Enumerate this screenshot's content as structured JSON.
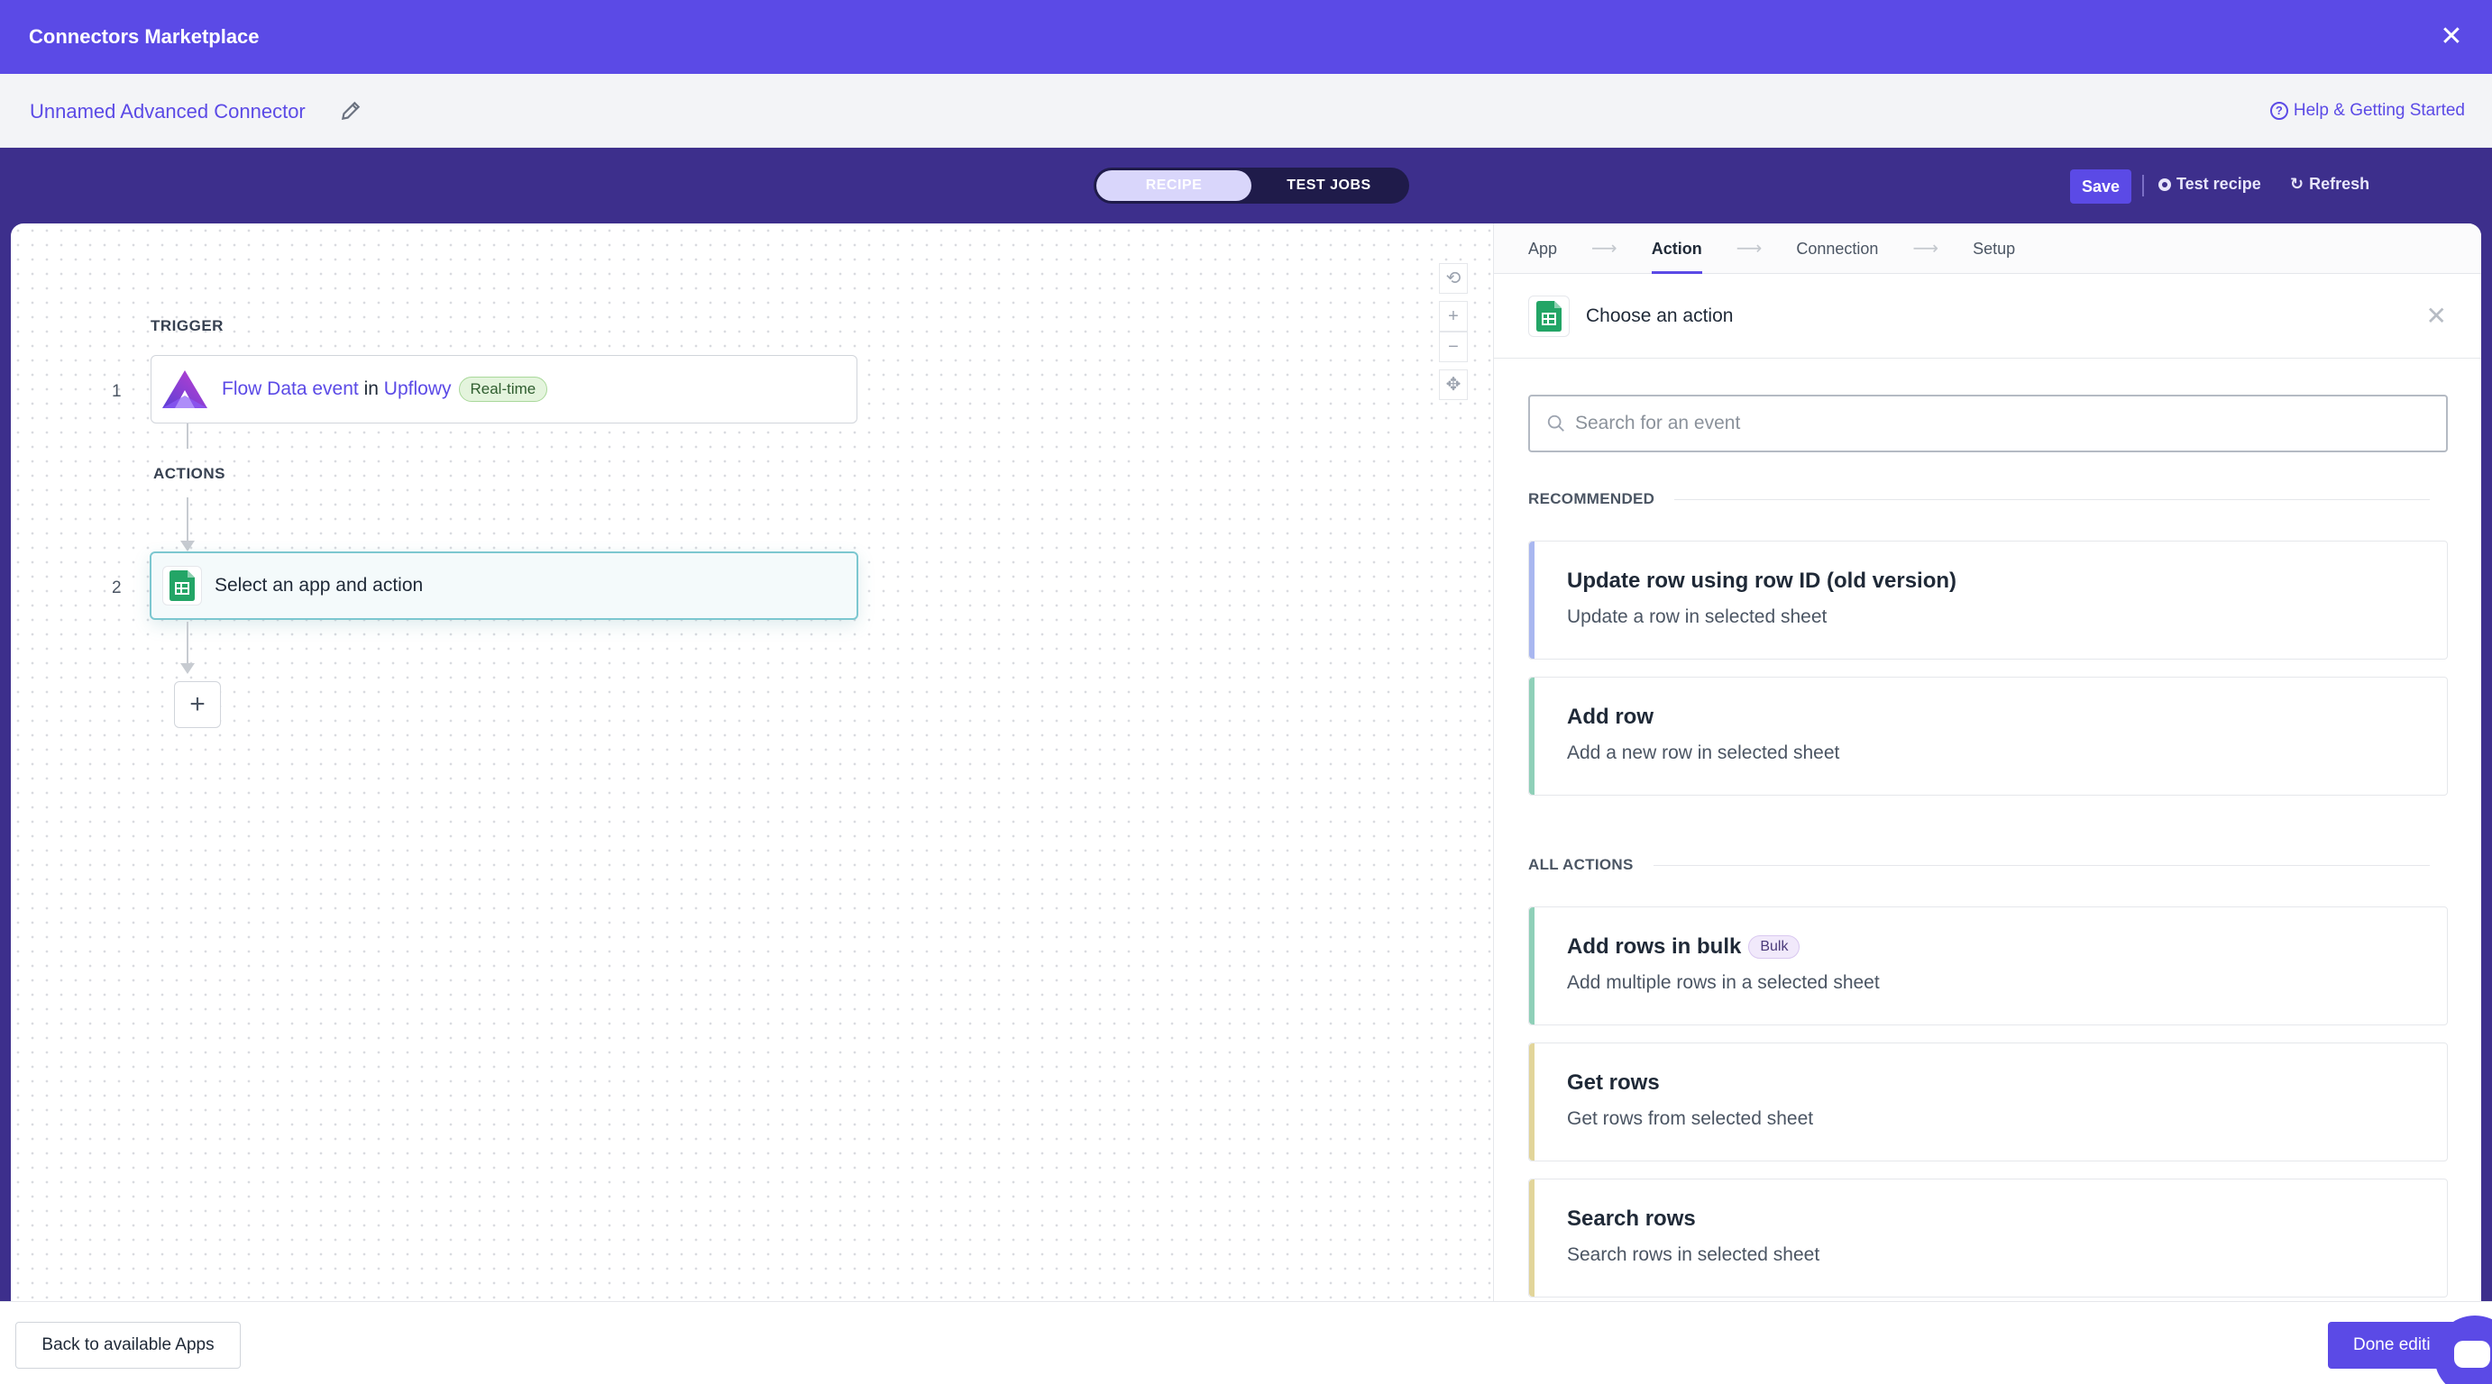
{
  "header": {
    "title": "Connectors Marketplace",
    "close_icon": "close-icon"
  },
  "subheader": {
    "connector_name": "Unnamed Advanced Connector",
    "edit_icon": "pencil-icon",
    "help_label": "Help & Getting Started",
    "help_icon": "question-circle-icon"
  },
  "toolbar": {
    "tabs": [
      {
        "label": "RECIPE",
        "active": true
      },
      {
        "label": "TEST JOBS",
        "active": false
      }
    ],
    "save_label": "Save",
    "test_recipe_label": "Test recipe",
    "refresh_label": "Refresh"
  },
  "canvas": {
    "trigger_heading": "TRIGGER",
    "actions_heading": "ACTIONS",
    "steps": [
      {
        "number": "1",
        "app_icon": "upflowy-logo",
        "event": "Flow Data event",
        "connector_word": "in",
        "app": "Upflowy",
        "badge": "Real-time"
      },
      {
        "number": "2",
        "app_icon": "google-sheets-icon",
        "label": "Select an app and action"
      }
    ],
    "controls": [
      "undo-icon",
      "zoom-in-icon",
      "zoom-out-icon",
      "fit-view-icon"
    ]
  },
  "panel": {
    "nav": [
      {
        "label": "App",
        "active": false
      },
      {
        "label": "Action",
        "active": true
      },
      {
        "label": "Connection",
        "active": false
      },
      {
        "label": "Setup",
        "active": false
      }
    ],
    "choose_title": "Choose an action",
    "search_placeholder": "Search for an event",
    "recommended_heading": "RECOMMENDED",
    "all_actions_heading": "ALL ACTIONS",
    "recommended": [
      {
        "title": "Update row using row ID (old version)",
        "desc": "Update a row in selected sheet",
        "accent": "#a9b7f0"
      },
      {
        "title": "Add row",
        "desc": "Add a new row in selected sheet",
        "accent": "#8fd0b8"
      }
    ],
    "all_actions": [
      {
        "title": "Add rows in bulk",
        "badge": "Bulk",
        "desc": "Add multiple rows in a selected sheet",
        "accent": "#8fd0b8"
      },
      {
        "title": "Get rows",
        "desc": "Get rows from selected sheet",
        "accent": "#e2d59a"
      },
      {
        "title": "Search rows",
        "desc": "Search rows in selected sheet",
        "accent": "#e2d59a"
      }
    ]
  },
  "footer": {
    "back_label": "Back to available Apps",
    "done_label": "Done editi"
  },
  "colors": {
    "brand": "#5b4ae6",
    "toolbar": "#3d2f8c"
  }
}
